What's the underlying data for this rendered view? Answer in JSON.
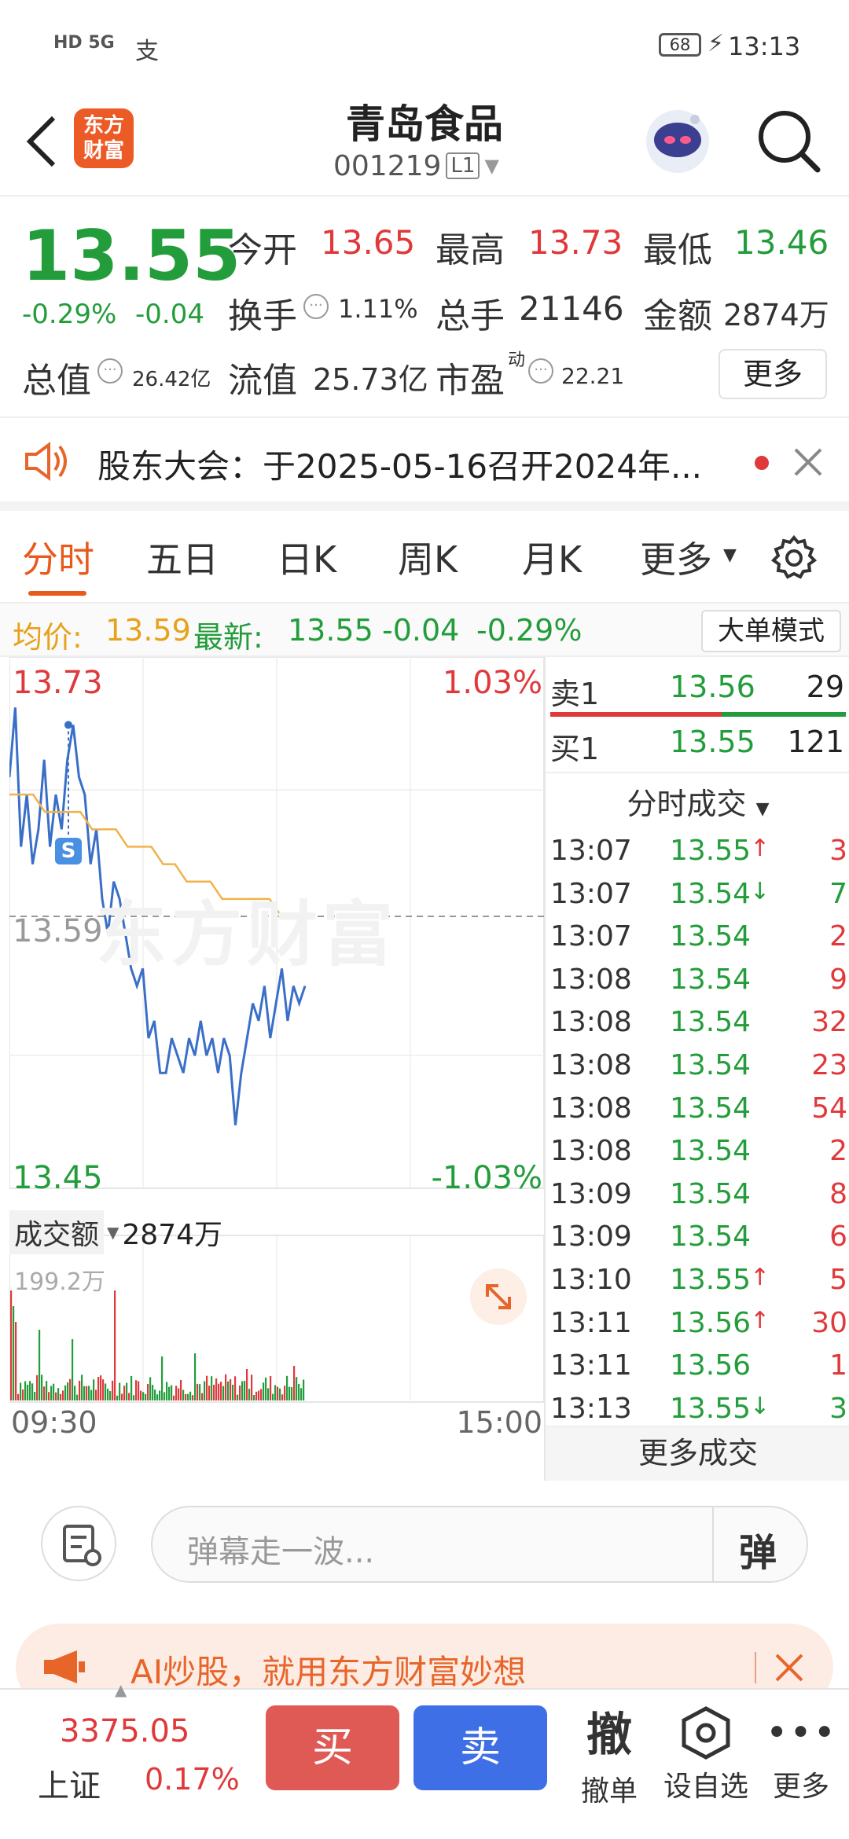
{
  "status_bar": {
    "left_icons": "HD 5G",
    "alipay": "支",
    "battery": "68",
    "time": "13:13"
  },
  "header": {
    "logo_line1": "东方",
    "logo_line2": "财富",
    "stock_name": "青岛食品",
    "stock_code": "001219",
    "level": "L1"
  },
  "quote": {
    "price": "13.55",
    "change_pct": "-0.29%",
    "change": "-0.04",
    "open_label": "今开",
    "open": "13.65",
    "high_label": "最高",
    "high": "13.73",
    "low_label": "最低",
    "low": "13.46",
    "turnover_label": "换手",
    "turnover": "1.11%",
    "volume_label": "总手",
    "volume": "21146",
    "amount_label": "金额",
    "amount": "2874万",
    "mktcap_label": "总值",
    "mktcap": "26.42亿",
    "float_label": "流值",
    "float_cap": "25.73亿",
    "pe_label": "市盈",
    "pe_sup": "动",
    "pe": "22.21",
    "more_button": "更多"
  },
  "notice": {
    "text": "股东大会：于2025-05-16召开2024年..."
  },
  "tabs": {
    "items": [
      "分时",
      "五日",
      "日K",
      "周K",
      "月K",
      "更多"
    ],
    "active": 0
  },
  "avg_bar": {
    "avg_label": "均价:",
    "avg": "13.59",
    "latest_label": "最新:",
    "latest": "13.55",
    "chg": "-0.04",
    "chg_pct": "-0.29%",
    "mode_button": "大单模式"
  },
  "chart_labels": {
    "top_price": "13.73",
    "mid_price": "13.59",
    "bottom_price": "13.45",
    "top_pct": "1.03%",
    "bottom_pct": "-1.03%",
    "vol_label": "成交额",
    "vol_total": "2874万",
    "vol_max": "199.2万",
    "time_start": "09:30",
    "time_end": "15:00",
    "marker": "S",
    "watermark": "东方财富"
  },
  "chart_data": {
    "type": "line",
    "title": "",
    "ylim": [
      13.45,
      13.73
    ],
    "pre_close": 13.59,
    "series": [
      {
        "name": "",
        "values": [
          13.67,
          13.71,
          13.63,
          13.66,
          13.62,
          13.64,
          13.68,
          13.63,
          13.66,
          13.64,
          13.68,
          13.7,
          13.67,
          13.66,
          13.62,
          13.64,
          13.6,
          13.58,
          13.61,
          13.6,
          13.58,
          13.56,
          13.55,
          13.56,
          13.52,
          13.53,
          13.5,
          13.5,
          13.52,
          13.51,
          13.5,
          13.52,
          13.51,
          13.53,
          13.51,
          13.52,
          13.5,
          13.52,
          13.51,
          13.47,
          13.5,
          13.52,
          13.54,
          13.53,
          13.55,
          13.52,
          13.54,
          13.56,
          13.53,
          13.55,
          13.54,
          13.55
        ]
      },
      {
        "name": "",
        "values": [
          13.66,
          13.66,
          13.66,
          13.65,
          13.65,
          13.65,
          13.65,
          13.64,
          13.64,
          13.64,
          13.63,
          13.63,
          13.63,
          13.62,
          13.62,
          13.61,
          13.61,
          13.61,
          13.6,
          13.6,
          13.6,
          13.6,
          13.6,
          13.59,
          13.59,
          13.59
        ]
      }
    ],
    "volume_max": "199.2万"
  },
  "order_book": {
    "sell_label": "卖1",
    "sell_price": "13.56",
    "sell_vol": "29",
    "buy_label": "买1",
    "buy_price": "13.55",
    "buy_vol": "121",
    "trades_header": "分时成交",
    "trades": [
      {
        "t": "13:07",
        "p": "13.55",
        "arrow": "↑",
        "v": "3"
      },
      {
        "t": "13:07",
        "p": "13.54",
        "arrow": "↓",
        "v": "7"
      },
      {
        "t": "13:07",
        "p": "13.54",
        "arrow": "",
        "v": "2"
      },
      {
        "t": "13:08",
        "p": "13.54",
        "arrow": "",
        "v": "9"
      },
      {
        "t": "13:08",
        "p": "13.54",
        "arrow": "",
        "v": "32"
      },
      {
        "t": "13:08",
        "p": "13.54",
        "arrow": "",
        "v": "23"
      },
      {
        "t": "13:08",
        "p": "13.54",
        "arrow": "",
        "v": "54"
      },
      {
        "t": "13:08",
        "p": "13.54",
        "arrow": "",
        "v": "2"
      },
      {
        "t": "13:09",
        "p": "13.54",
        "arrow": "",
        "v": "8"
      },
      {
        "t": "13:09",
        "p": "13.54",
        "arrow": "",
        "v": "6"
      },
      {
        "t": "13:10",
        "p": "13.55",
        "arrow": "↑",
        "v": "5"
      },
      {
        "t": "13:11",
        "p": "13.56",
        "arrow": "↑",
        "v": "30"
      },
      {
        "t": "13:11",
        "p": "13.56",
        "arrow": "",
        "v": "1"
      },
      {
        "t": "13:13",
        "p": "13.55",
        "arrow": "↓",
        "v": "3"
      }
    ],
    "more_trades": "更多成交"
  },
  "comment": {
    "placeholder": "弹幕走一波...",
    "danmu_button": "弹"
  },
  "ad": {
    "text": "AI炒股，就用东方财富妙想"
  },
  "bottom_bar": {
    "index_value": "3375.05",
    "index_name": "上证",
    "index_pct": "0.17%",
    "buy": "买",
    "sell": "卖",
    "cancel_icon": "撤",
    "cancel": "撤单",
    "watch": "设自选",
    "more": "更多"
  }
}
